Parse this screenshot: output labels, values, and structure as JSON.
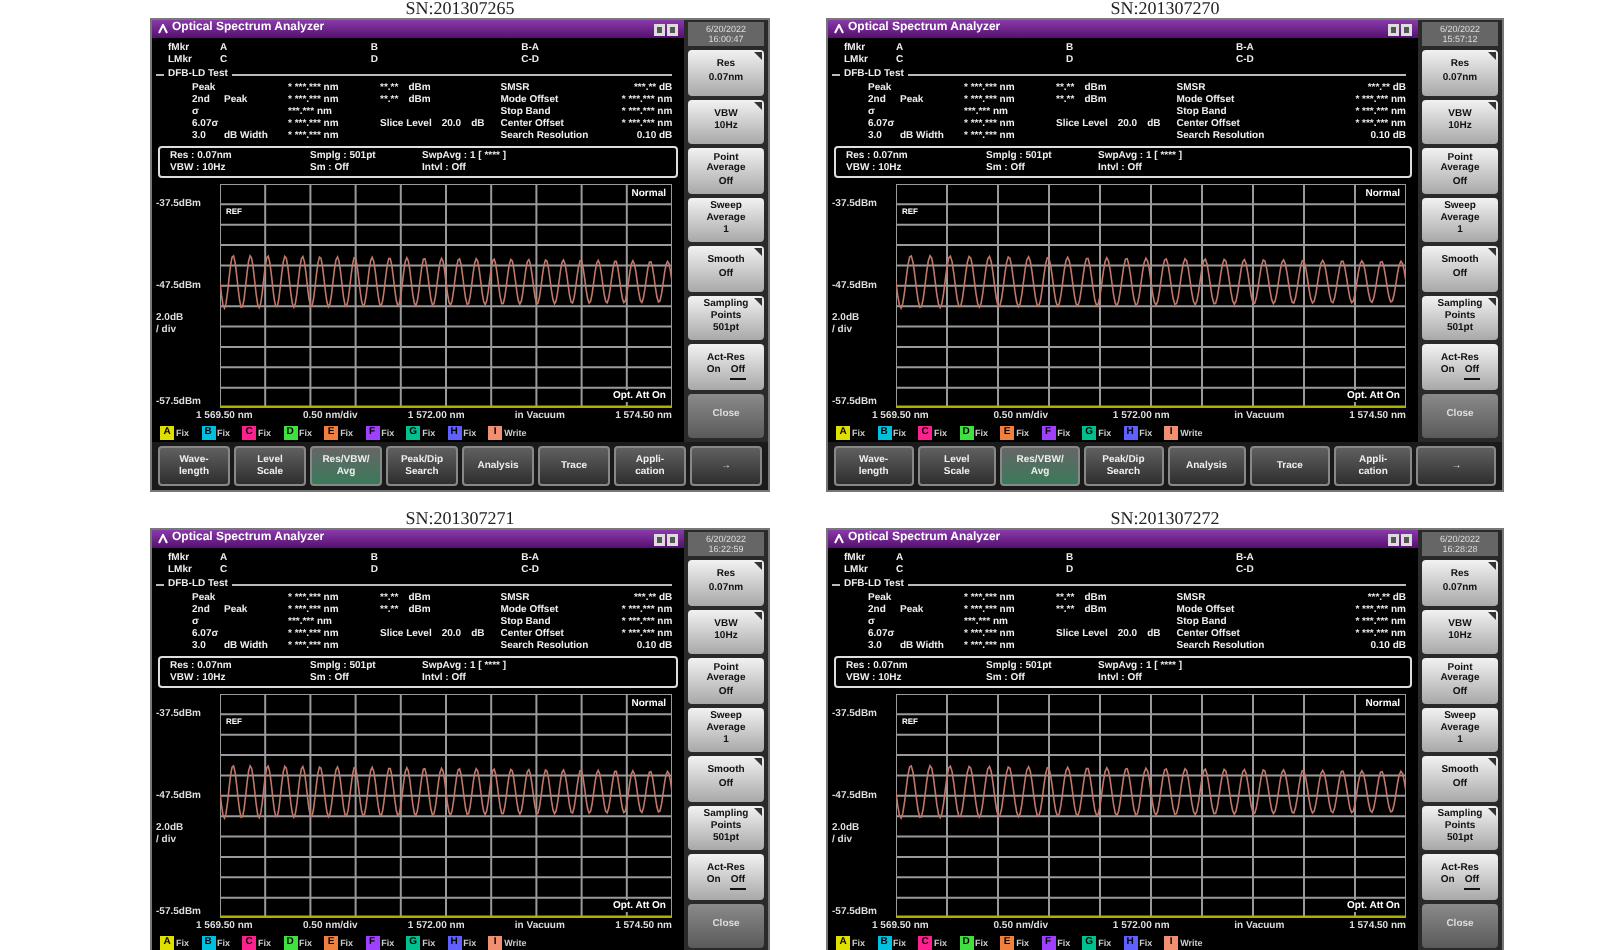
{
  "panels": [
    {
      "caption": "SN:201307265",
      "title": "Optical Spectrum Analyzer",
      "date": "6/20/2022",
      "time": "16:00:47",
      "markers": [
        [
          "fMkr",
          "A",
          "B",
          "B-A"
        ],
        [
          "LMkr",
          "C",
          "D",
          "C-D"
        ]
      ],
      "test_title": "DFB-LD Test",
      "results": [
        {
          "label": [
            "Peak"
          ],
          "value": "* ***.*** nm",
          "middle": [
            "**.**",
            "dBm"
          ],
          "name": "SMSR",
          "reading": "***.** dB"
        },
        {
          "label": [
            "2nd",
            "Peak"
          ],
          "value": "* ***.*** nm",
          "middle": [
            "**.**",
            "dBm"
          ],
          "name": "Mode Offset",
          "reading": "* ***.*** nm"
        },
        {
          "label": [
            "σ"
          ],
          "value": "***.*** nm",
          "name": "Stop Band",
          "reading": "* ***.*** nm"
        },
        {
          "label": [
            "6.07σ"
          ],
          "value": "* ***.*** nm",
          "middle": [
            "Slice Level",
            "20.0",
            "dB"
          ],
          "name": "Center Offset",
          "reading": "* ***.*** nm"
        },
        {
          "label": [
            "3.0",
            "dB Width"
          ],
          "value": "* ***.*** nm",
          "name": "Search Resolution",
          "reading": "0.10 dB"
        }
      ],
      "info": [
        [
          "Res : 0.07nm",
          "Smplg : 501pt",
          "SwpAvg : 1 [ **** ]"
        ],
        [
          "VBW : 10Hz",
          "Sm : Off",
          "Intvl : Off"
        ]
      ],
      "chart": {
        "mode": "Normal",
        "ref": "REF",
        "att": "Opt. Att On",
        "y_labels": [
          "-37.5dBm",
          "-47.5dBm",
          "-57.5dBm"
        ],
        "scale": [
          "2.0dB",
          "/ div"
        ],
        "x_labels": [
          "1 569.50 nm",
          "0.50 nm/div",
          "1 572.00 nm",
          "in Vacuum",
          "1 574.50 nm"
        ]
      },
      "legend": [
        {
          "letter": "A",
          "label": "Fix",
          "color": "#e0e000"
        },
        {
          "letter": "B",
          "label": "Fix",
          "color": "#00c0e0"
        },
        {
          "letter": "C",
          "label": "Fix",
          "color": "#ff2090"
        },
        {
          "letter": "D",
          "label": "Fix",
          "color": "#40e040"
        },
        {
          "letter": "E",
          "label": "Fix",
          "color": "#f08040"
        },
        {
          "letter": "F",
          "label": "Fix",
          "color": "#a040ff"
        },
        {
          "letter": "G",
          "label": "Fix",
          "color": "#00c090"
        },
        {
          "letter": "H",
          "label": "Fix",
          "color": "#6060ff"
        },
        {
          "letter": "I",
          "label": "Write",
          "color": "#f09070"
        }
      ],
      "softkeys": [
        {
          "kind": "setting",
          "lines": [
            "Res"
          ],
          "value": "0.07nm",
          "corner_mark": true
        },
        {
          "kind": "setting",
          "lines": [
            "VBW"
          ],
          "value": "10Hz",
          "corner_mark": true
        },
        {
          "kind": "setting",
          "lines": [
            "Point",
            "Average"
          ],
          "value": "Off"
        },
        {
          "kind": "setting",
          "lines": [
            "Sweep",
            "Average"
          ],
          "value": "1"
        },
        {
          "kind": "setting",
          "lines": [
            "Smooth"
          ],
          "value": "Off",
          "corner_mark": true
        },
        {
          "kind": "setting",
          "lines": [
            "Sampling",
            "Points"
          ],
          "value": "501pt",
          "corner_mark": true
        },
        {
          "kind": "toggle",
          "lines": [
            "Act-Res"
          ],
          "options": [
            {
              "label": "On",
              "selected": false
            },
            {
              "label": "Off",
              "selected": true
            }
          ]
        },
        {
          "kind": "action",
          "lines": [
            "Close"
          ]
        }
      ],
      "menu": [
        {
          "lines": [
            "Wave-",
            "length"
          ],
          "selected": false
        },
        {
          "lines": [
            "Level",
            "Scale"
          ],
          "selected": false
        },
        {
          "lines": [
            "Res/VBW/",
            "Avg"
          ],
          "selected": true
        },
        {
          "lines": [
            "Peak/Dip",
            "Search"
          ],
          "selected": false
        },
        {
          "lines": [
            "Analysis"
          ],
          "selected": false
        },
        {
          "lines": [
            "Trace"
          ],
          "selected": false
        },
        {
          "lines": [
            "Appli-",
            "cation"
          ],
          "selected": false
        },
        {
          "lines": [
            "→"
          ],
          "selected": false
        }
      ]
    },
    {
      "caption": "SN:201307270",
      "title": "Optical Spectrum Analyzer",
      "date": "6/20/2022",
      "time": "15:57:12",
      "markers": [
        [
          "fMkr",
          "A",
          "B",
          "B-A"
        ],
        [
          "LMkr",
          "C",
          "D",
          "C-D"
        ]
      ],
      "test_title": "DFB-LD Test",
      "results": [
        {
          "label": [
            "Peak"
          ],
          "value": "* ***.*** nm",
          "middle": [
            "**.**",
            "dBm"
          ],
          "name": "SMSR",
          "reading": "***.** dB"
        },
        {
          "label": [
            "2nd",
            "Peak"
          ],
          "value": "* ***.*** nm",
          "middle": [
            "**.**",
            "dBm"
          ],
          "name": "Mode Offset",
          "reading": "* ***.*** nm"
        },
        {
          "label": [
            "σ"
          ],
          "value": "***.*** nm",
          "name": "Stop Band",
          "reading": "* ***.*** nm"
        },
        {
          "label": [
            "6.07σ"
          ],
          "value": "* ***.*** nm",
          "middle": [
            "Slice Level",
            "20.0",
            "dB"
          ],
          "name": "Center Offset",
          "reading": "* ***.*** nm"
        },
        {
          "label": [
            "3.0",
            "dB Width"
          ],
          "value": "* ***.*** nm",
          "name": "Search Resolution",
          "reading": "0.10 dB"
        }
      ],
      "info": [
        [
          "Res : 0.07nm",
          "Smplg : 501pt",
          "SwpAvg : 1 [ **** ]"
        ],
        [
          "VBW : 10Hz",
          "Sm : Off",
          "Intvl : Off"
        ]
      ],
      "chart": {
        "mode": "Normal",
        "ref": "REF",
        "att": "Opt. Att On",
        "y_labels": [
          "-37.5dBm",
          "-47.5dBm",
          "-57.5dBm"
        ],
        "scale": [
          "2.0dB",
          "/ div"
        ],
        "x_labels": [
          "1 569.50 nm",
          "0.50 nm/div",
          "1 572.00 nm",
          "in Vacuum",
          "1 574.50 nm"
        ]
      },
      "legend": [
        {
          "letter": "A",
          "label": "Fix",
          "color": "#e0e000"
        },
        {
          "letter": "B",
          "label": "Fix",
          "color": "#00c0e0"
        },
        {
          "letter": "C",
          "label": "Fix",
          "color": "#ff2090"
        },
        {
          "letter": "D",
          "label": "Fix",
          "color": "#40e040"
        },
        {
          "letter": "E",
          "label": "Fix",
          "color": "#f08040"
        },
        {
          "letter": "F",
          "label": "Fix",
          "color": "#a040ff"
        },
        {
          "letter": "G",
          "label": "Fix",
          "color": "#00c090"
        },
        {
          "letter": "H",
          "label": "Fix",
          "color": "#6060ff"
        },
        {
          "letter": "I",
          "label": "Write",
          "color": "#f09070"
        }
      ],
      "softkeys": [
        {
          "kind": "setting",
          "lines": [
            "Res"
          ],
          "value": "0.07nm",
          "corner_mark": true
        },
        {
          "kind": "setting",
          "lines": [
            "VBW"
          ],
          "value": "10Hz",
          "corner_mark": true
        },
        {
          "kind": "setting",
          "lines": [
            "Point",
            "Average"
          ],
          "value": "Off"
        },
        {
          "kind": "setting",
          "lines": [
            "Sweep",
            "Average"
          ],
          "value": "1"
        },
        {
          "kind": "setting",
          "lines": [
            "Smooth"
          ],
          "value": "Off",
          "corner_mark": true
        },
        {
          "kind": "setting",
          "lines": [
            "Sampling",
            "Points"
          ],
          "value": "501pt",
          "corner_mark": true
        },
        {
          "kind": "toggle",
          "lines": [
            "Act-Res"
          ],
          "options": [
            {
              "label": "On",
              "selected": false
            },
            {
              "label": "Off",
              "selected": true
            }
          ]
        },
        {
          "kind": "action",
          "lines": [
            "Close"
          ]
        }
      ],
      "menu": [
        {
          "lines": [
            "Wave-",
            "length"
          ],
          "selected": false
        },
        {
          "lines": [
            "Level",
            "Scale"
          ],
          "selected": false
        },
        {
          "lines": [
            "Res/VBW/",
            "Avg"
          ],
          "selected": true
        },
        {
          "lines": [
            "Peak/Dip",
            "Search"
          ],
          "selected": false
        },
        {
          "lines": [
            "Analysis"
          ],
          "selected": false
        },
        {
          "lines": [
            "Trace"
          ],
          "selected": false
        },
        {
          "lines": [
            "Appli-",
            "cation"
          ],
          "selected": false
        },
        {
          "lines": [
            "→"
          ],
          "selected": false
        }
      ]
    },
    {
      "caption": "SN:201307271",
      "title": "Optical Spectrum Analyzer",
      "date": "6/20/2022",
      "time": "16:22:59",
      "markers": [
        [
          "fMkr",
          "A",
          "B",
          "B-A"
        ],
        [
          "LMkr",
          "C",
          "D",
          "C-D"
        ]
      ],
      "test_title": "DFB-LD Test",
      "results": [
        {
          "label": [
            "Peak"
          ],
          "value": "* ***.*** nm",
          "middle": [
            "**.**",
            "dBm"
          ],
          "name": "SMSR",
          "reading": "***.** dB"
        },
        {
          "label": [
            "2nd",
            "Peak"
          ],
          "value": "* ***.*** nm",
          "middle": [
            "**.**",
            "dBm"
          ],
          "name": "Mode Offset",
          "reading": "* ***.*** nm"
        },
        {
          "label": [
            "σ"
          ],
          "value": "***.*** nm",
          "name": "Stop Band",
          "reading": "* ***.*** nm"
        },
        {
          "label": [
            "6.07σ"
          ],
          "value": "* ***.*** nm",
          "middle": [
            "Slice Level",
            "20.0",
            "dB"
          ],
          "name": "Center Offset",
          "reading": "* ***.*** nm"
        },
        {
          "label": [
            "3.0",
            "dB Width"
          ],
          "value": "* ***.*** nm",
          "name": "Search Resolution",
          "reading": "0.10 dB"
        }
      ],
      "info": [
        [
          "Res : 0.07nm",
          "Smplg : 501pt",
          "SwpAvg : 1 [ **** ]"
        ],
        [
          "VBW : 10Hz",
          "Sm : Off",
          "Intvl : Off"
        ]
      ],
      "chart": {
        "mode": "Normal",
        "ref": "REF",
        "att": "Opt. Att On",
        "y_labels": [
          "-37.5dBm",
          "-47.5dBm",
          "-57.5dBm"
        ],
        "scale": [
          "2.0dB",
          "/ div"
        ],
        "x_labels": [
          "1 569.50 nm",
          "0.50 nm/div",
          "1 572.00 nm",
          "in Vacuum",
          "1 574.50 nm"
        ]
      },
      "legend": [
        {
          "letter": "A",
          "label": "Fix",
          "color": "#e0e000"
        },
        {
          "letter": "B",
          "label": "Fix",
          "color": "#00c0e0"
        },
        {
          "letter": "C",
          "label": "Fix",
          "color": "#ff2090"
        },
        {
          "letter": "D",
          "label": "Fix",
          "color": "#40e040"
        },
        {
          "letter": "E",
          "label": "Fix",
          "color": "#f08040"
        },
        {
          "letter": "F",
          "label": "Fix",
          "color": "#a040ff"
        },
        {
          "letter": "G",
          "label": "Fix",
          "color": "#00c090"
        },
        {
          "letter": "H",
          "label": "Fix",
          "color": "#6060ff"
        },
        {
          "letter": "I",
          "label": "Write",
          "color": "#f09070"
        }
      ],
      "softkeys": [
        {
          "kind": "setting",
          "lines": [
            "Res"
          ],
          "value": "0.07nm",
          "corner_mark": true
        },
        {
          "kind": "setting",
          "lines": [
            "VBW"
          ],
          "value": "10Hz",
          "corner_mark": true
        },
        {
          "kind": "setting",
          "lines": [
            "Point",
            "Average"
          ],
          "value": "Off"
        },
        {
          "kind": "setting",
          "lines": [
            "Sweep",
            "Average"
          ],
          "value": "1"
        },
        {
          "kind": "setting",
          "lines": [
            "Smooth"
          ],
          "value": "Off",
          "corner_mark": true
        },
        {
          "kind": "setting",
          "lines": [
            "Sampling",
            "Points"
          ],
          "value": "501pt",
          "corner_mark": true
        },
        {
          "kind": "toggle",
          "lines": [
            "Act-Res"
          ],
          "options": [
            {
              "label": "On",
              "selected": false
            },
            {
              "label": "Off",
              "selected": true
            }
          ]
        },
        {
          "kind": "action",
          "lines": [
            "Close"
          ]
        }
      ]
    },
    {
      "caption": "SN:201307272",
      "title": "Optical Spectrum Analyzer",
      "date": "6/20/2022",
      "time": "16:28:28",
      "markers": [
        [
          "fMkr",
          "A",
          "B",
          "B-A"
        ],
        [
          "LMkr",
          "C",
          "D",
          "C-D"
        ]
      ],
      "test_title": "DFB-LD Test",
      "results": [
        {
          "label": [
            "Peak"
          ],
          "value": "* ***.*** nm",
          "middle": [
            "**.**",
            "dBm"
          ],
          "name": "SMSR",
          "reading": "***.** dB"
        },
        {
          "label": [
            "2nd",
            "Peak"
          ],
          "value": "* ***.*** nm",
          "middle": [
            "**.**",
            "dBm"
          ],
          "name": "Mode Offset",
          "reading": "* ***.*** nm"
        },
        {
          "label": [
            "σ"
          ],
          "value": "***.*** nm",
          "name": "Stop Band",
          "reading": "* ***.*** nm"
        },
        {
          "label": [
            "6.07σ"
          ],
          "value": "* ***.*** nm",
          "middle": [
            "Slice Level",
            "20.0",
            "dB"
          ],
          "name": "Center Offset",
          "reading": "* ***.*** nm"
        },
        {
          "label": [
            "3.0",
            "dB Width"
          ],
          "value": "* ***.*** nm",
          "name": "Search Resolution",
          "reading": "0.10 dB"
        }
      ],
      "info": [
        [
          "Res : 0.07nm",
          "Smplg : 501pt",
          "SwpAvg : 1 [ **** ]"
        ],
        [
          "VBW : 10Hz",
          "Sm : Off",
          "Intvl : Off"
        ]
      ],
      "chart": {
        "mode": "Normal",
        "ref": "REF",
        "att": "Opt. Att On",
        "y_labels": [
          "-37.5dBm",
          "-47.5dBm",
          "-57.5dBm"
        ],
        "scale": [
          "2.0dB",
          "/ div"
        ],
        "x_labels": [
          "1 569.50 nm",
          "0.50 nm/div",
          "1 572.00 nm",
          "in Vacuum",
          "1 574.50 nm"
        ]
      },
      "legend": [
        {
          "letter": "A",
          "label": "Fix",
          "color": "#e0e000"
        },
        {
          "letter": "B",
          "label": "Fix",
          "color": "#00c0e0"
        },
        {
          "letter": "C",
          "label": "Fix",
          "color": "#ff2090"
        },
        {
          "letter": "D",
          "label": "Fix",
          "color": "#40e040"
        },
        {
          "letter": "E",
          "label": "Fix",
          "color": "#f08040"
        },
        {
          "letter": "F",
          "label": "Fix",
          "color": "#a040ff"
        },
        {
          "letter": "G",
          "label": "Fix",
          "color": "#00c090"
        },
        {
          "letter": "H",
          "label": "Fix",
          "color": "#6060ff"
        },
        {
          "letter": "I",
          "label": "Write",
          "color": "#f09070"
        }
      ],
      "softkeys": [
        {
          "kind": "setting",
          "lines": [
            "Res"
          ],
          "value": "0.07nm",
          "corner_mark": true
        },
        {
          "kind": "setting",
          "lines": [
            "VBW"
          ],
          "value": "10Hz",
          "corner_mark": true
        },
        {
          "kind": "setting",
          "lines": [
            "Point",
            "Average"
          ],
          "value": "Off"
        },
        {
          "kind": "setting",
          "lines": [
            "Sweep",
            "Average"
          ],
          "value": "1"
        },
        {
          "kind": "setting",
          "lines": [
            "Smooth"
          ],
          "value": "Off",
          "corner_mark": true
        },
        {
          "kind": "setting",
          "lines": [
            "Sampling",
            "Points"
          ],
          "value": "501pt",
          "corner_mark": true
        },
        {
          "kind": "toggle",
          "lines": [
            "Act-Res"
          ],
          "options": [
            {
              "label": "On",
              "selected": false
            },
            {
              "label": "Off",
              "selected": true
            }
          ]
        },
        {
          "kind": "action",
          "lines": [
            "Close"
          ]
        }
      ]
    }
  ]
}
